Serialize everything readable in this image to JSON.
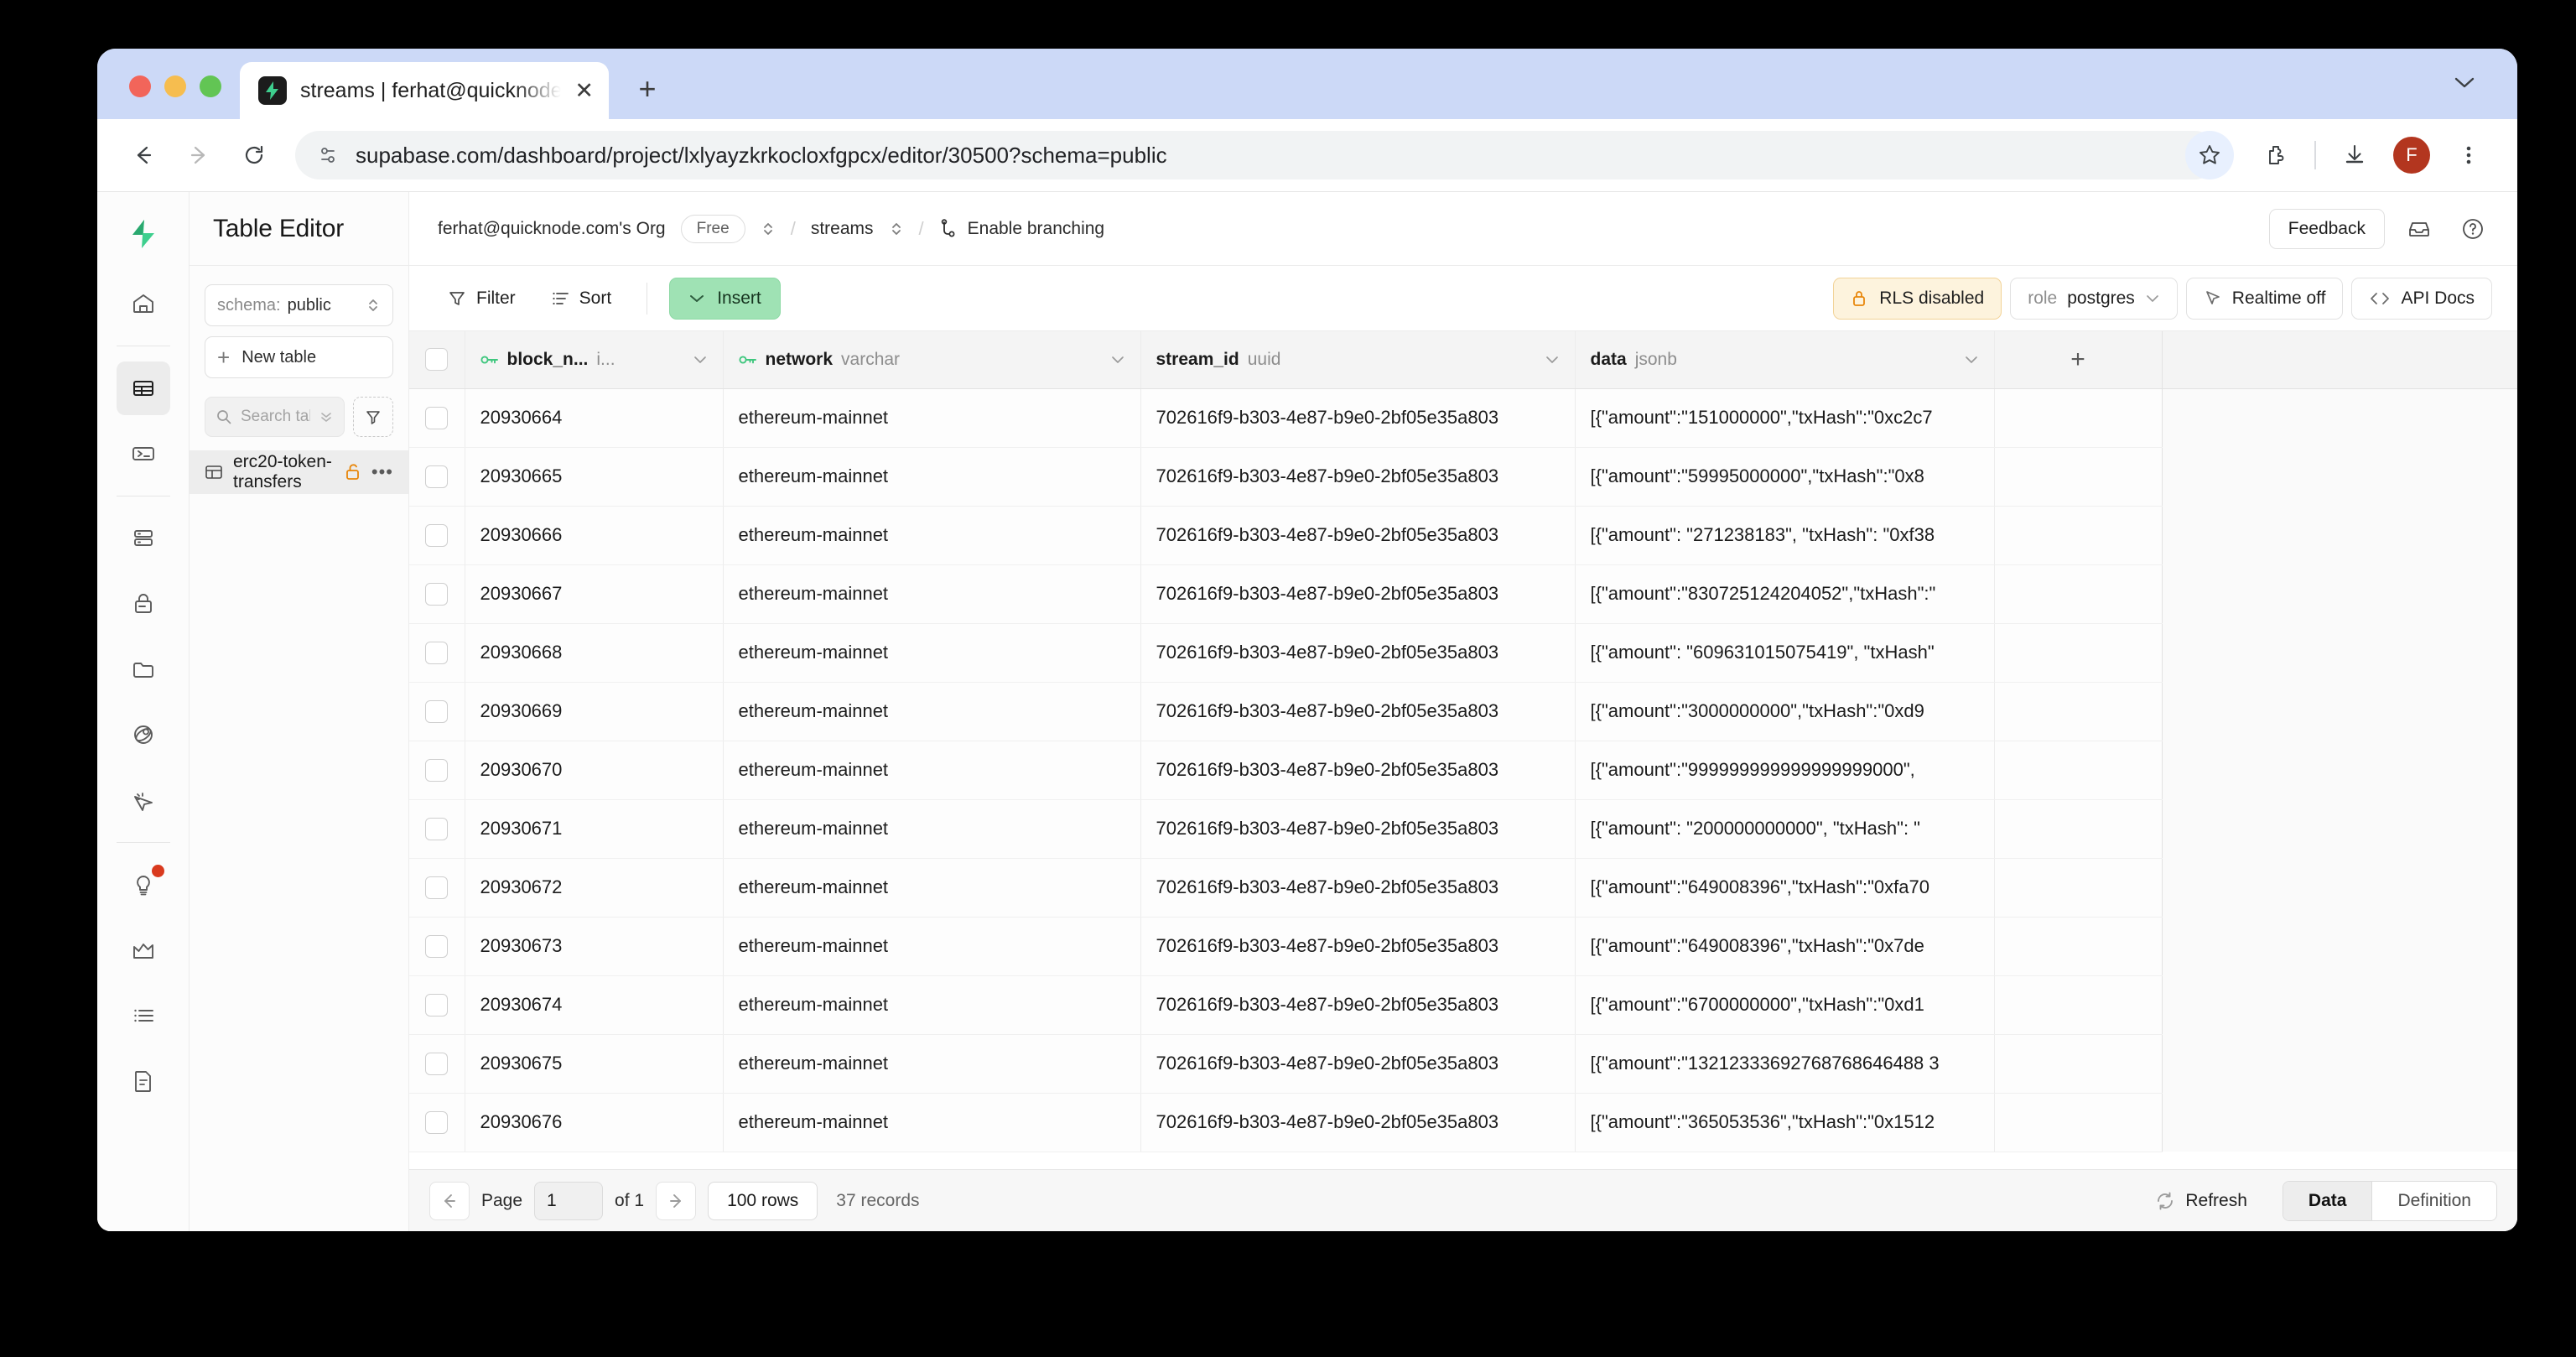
{
  "browser": {
    "tab": {
      "title": "streams | ferhat@quicknode.c",
      "favicon": "lightning-bolt-icon",
      "close": "✕"
    },
    "newtab_label": "+",
    "url": "supabase.com/dashboard/project/lxlyayzkrkocloxfgpcx/editor/30500?schema=public",
    "avatar_letter": "F"
  },
  "rail": {
    "items": [
      {
        "name": "home-icon",
        "label": "Home"
      },
      {
        "name": "table-editor-icon",
        "label": "Table Editor",
        "active": true
      },
      {
        "name": "sql-editor-icon",
        "label": "SQL Editor"
      },
      {
        "name": "database-icon",
        "label": "Database"
      },
      {
        "name": "auth-icon",
        "label": "Authentication"
      },
      {
        "name": "storage-icon",
        "label": "Storage"
      },
      {
        "name": "edge-functions-icon",
        "label": "Edge Functions"
      },
      {
        "name": "realtime-icon",
        "label": "Realtime"
      },
      {
        "name": "advisors-icon",
        "label": "Advisors",
        "badge": true
      },
      {
        "name": "reports-icon",
        "label": "Reports"
      },
      {
        "name": "logs-icon",
        "label": "Logs"
      },
      {
        "name": "api-docs-icon",
        "label": "API Docs"
      }
    ]
  },
  "panel": {
    "title": "Table Editor",
    "schema_label": "schema:",
    "schema_value": "public",
    "new_table_label": "New table",
    "search_placeholder": "Search tables...",
    "search_value": "",
    "tables": [
      {
        "name": "erc20-token-transfers",
        "locked": true,
        "selected": true
      }
    ]
  },
  "topbar": {
    "org": "ferhat@quicknode.com's Org",
    "plan": "Free",
    "project": "streams",
    "branching": "Enable branching",
    "feedback": "Feedback",
    "slash": "/"
  },
  "toolbar": {
    "filter": "Filter",
    "sort": "Sort",
    "insert": "Insert",
    "rls": "RLS disabled",
    "role_label": "role",
    "role_value": "postgres",
    "realtime": "Realtime off",
    "api_docs": "API Docs"
  },
  "grid": {
    "columns": [
      {
        "name": "block_n...",
        "type": "i...",
        "pk": true,
        "chevron": true
      },
      {
        "name": "network",
        "type": "varchar",
        "pk": true,
        "chevron": true
      },
      {
        "name": "stream_id",
        "type": "uuid",
        "pk": false,
        "chevron": true
      },
      {
        "name": "data",
        "type": "jsonb",
        "pk": false,
        "chevron": true
      }
    ],
    "add_column": "+",
    "rows": [
      {
        "block_number": "20930664",
        "network": "ethereum-mainnet",
        "stream_id": "702616f9-b303-4e87-b9e0-2bf05e35a803",
        "data": "[{\"amount\":\"151000000\",\"txHash\":\"0xc2c7"
      },
      {
        "block_number": "20930665",
        "network": "ethereum-mainnet",
        "stream_id": "702616f9-b303-4e87-b9e0-2bf05e35a803",
        "data": "[{\"amount\":\"59995000000\",\"txHash\":\"0x8"
      },
      {
        "block_number": "20930666",
        "network": "ethereum-mainnet",
        "stream_id": "702616f9-b303-4e87-b9e0-2bf05e35a803",
        "data": "[{\"amount\": \"271238183\", \"txHash\": \"0xf38"
      },
      {
        "block_number": "20930667",
        "network": "ethereum-mainnet",
        "stream_id": "702616f9-b303-4e87-b9e0-2bf05e35a803",
        "data": "[{\"amount\":\"830725124204052\",\"txHash\":\""
      },
      {
        "block_number": "20930668",
        "network": "ethereum-mainnet",
        "stream_id": "702616f9-b303-4e87-b9e0-2bf05e35a803",
        "data": "[{\"amount\": \"609631015075419\", \"txHash\""
      },
      {
        "block_number": "20930669",
        "network": "ethereum-mainnet",
        "stream_id": "702616f9-b303-4e87-b9e0-2bf05e35a803",
        "data": "[{\"amount\":\"3000000000\",\"txHash\":\"0xd9"
      },
      {
        "block_number": "20930670",
        "network": "ethereum-mainnet",
        "stream_id": "702616f9-b303-4e87-b9e0-2bf05e35a803",
        "data": "[{\"amount\":\"999999999999999999000\","
      },
      {
        "block_number": "20930671",
        "network": "ethereum-mainnet",
        "stream_id": "702616f9-b303-4e87-b9e0-2bf05e35a803",
        "data": "[{\"amount\": \"200000000000\", \"txHash\": \""
      },
      {
        "block_number": "20930672",
        "network": "ethereum-mainnet",
        "stream_id": "702616f9-b303-4e87-b9e0-2bf05e35a803",
        "data": "[{\"amount\":\"649008396\",\"txHash\":\"0xfa70"
      },
      {
        "block_number": "20930673",
        "network": "ethereum-mainnet",
        "stream_id": "702616f9-b303-4e87-b9e0-2bf05e35a803",
        "data": "[{\"amount\":\"649008396\",\"txHash\":\"0x7de"
      },
      {
        "block_number": "20930674",
        "network": "ethereum-mainnet",
        "stream_id": "702616f9-b303-4e87-b9e0-2bf05e35a803",
        "data": "[{\"amount\":\"6700000000\",\"txHash\":\"0xd1"
      },
      {
        "block_number": "20930675",
        "network": "ethereum-mainnet",
        "stream_id": "702616f9-b303-4e87-b9e0-2bf05e35a803",
        "data": "[{\"amount\":\"13212333692768768646488 3"
      },
      {
        "block_number": "20930676",
        "network": "ethereum-mainnet",
        "stream_id": "702616f9-b303-4e87-b9e0-2bf05e35a803",
        "data": "[{\"amount\":\"365053536\",\"txHash\":\"0x1512"
      }
    ]
  },
  "footer": {
    "page_label": "Page",
    "page_value": "1",
    "of_label": "of 1",
    "rows_per_page": "100 rows",
    "records": "37 records",
    "refresh": "Refresh",
    "data_tab": "Data",
    "definition_tab": "Definition"
  }
}
